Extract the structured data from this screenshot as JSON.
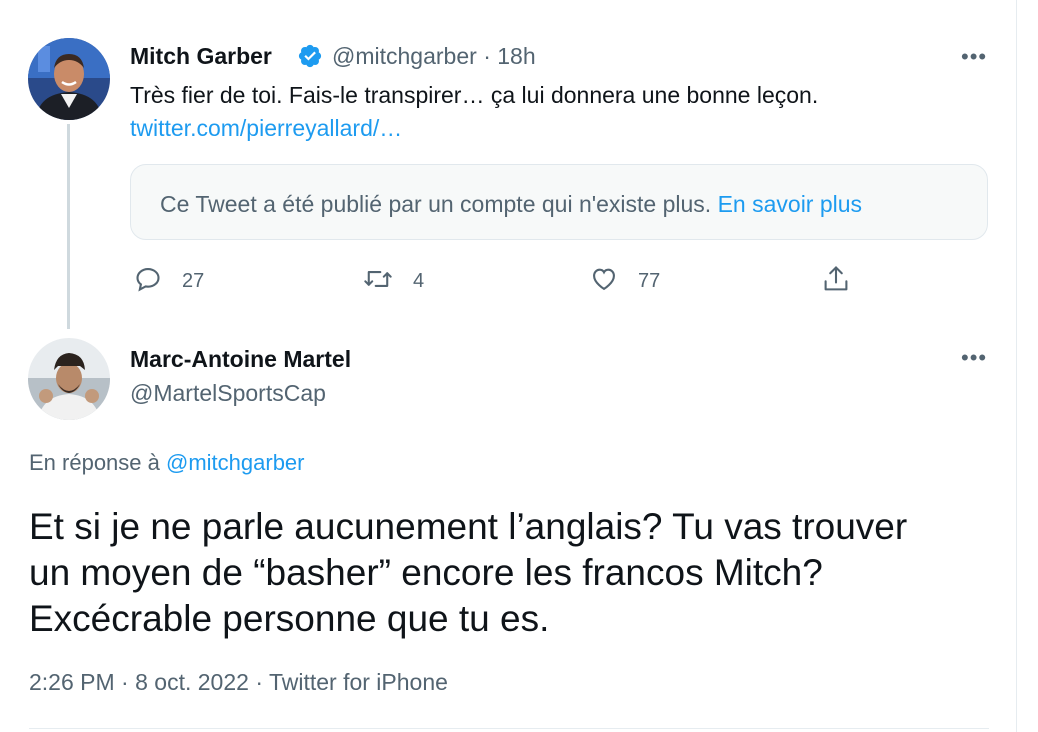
{
  "tweet1": {
    "name": "Mitch Garber",
    "handle": "@mitchgarber",
    "time": "18h",
    "text": "Très fier de toi. Fais-le transpirer… ça lui donnera une bonne leçon.",
    "link": "twitter.com/pierreyallard/…",
    "unavailable": {
      "text": "Ce Tweet a été publié par un compte qui n'existe plus.",
      "learn_more": "En savoir plus"
    },
    "actions": {
      "replies": "27",
      "retweets": "4",
      "likes": "77"
    }
  },
  "tweet2": {
    "name": "Marc-Antoine Martel",
    "handle": "@MartelSportsCap",
    "reply_prefix": "En réponse à",
    "reply_to": "@mitchgarber",
    "text_lines": [
      "Et si je ne parle aucunement l’anglais? Tu vas trouver",
      "un moyen de “basher” encore les francos Mitch?",
      "Excécrable personne que tu es."
    ],
    "time": "2:26 PM",
    "date": "8 oct. 2022",
    "source": "Twitter for iPhone"
  },
  "icons": {
    "verified": "verified-badge-icon",
    "reply": "reply-icon",
    "retweet": "retweet-icon",
    "like": "heart-icon",
    "share": "share-icon",
    "more": "more-horizontal-icon"
  },
  "colors": {
    "accent": "#1d9bf0",
    "secondary_text": "#536471",
    "primary_text": "#0f1419",
    "thread_line": "#cfd9de"
  }
}
